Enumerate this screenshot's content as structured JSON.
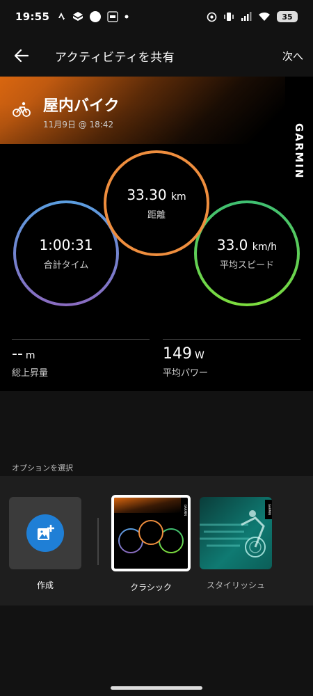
{
  "status_bar": {
    "time": "19:55",
    "battery": "35"
  },
  "header": {
    "title": "アクティビティを共有",
    "next_label": "次へ"
  },
  "activity": {
    "title": "屋内バイク",
    "date": "11月9日 @ 18:42",
    "brand": "GARMIN",
    "brand_color": "#d9660f"
  },
  "metrics": {
    "time": {
      "value": "1:00:31",
      "label": "合計タイム"
    },
    "distance": {
      "value": "33.30",
      "unit": "km",
      "label": "距離"
    },
    "speed": {
      "value": "33.0",
      "unit": "km/h",
      "label": "平均スピード"
    }
  },
  "stats": [
    {
      "value": "--",
      "unit": "m",
      "label": "総上昇量"
    },
    {
      "value": "149",
      "unit": "W",
      "label": "平均パワー"
    }
  ],
  "options": {
    "section_label": "オプションを選択",
    "items": [
      {
        "label": "作成"
      },
      {
        "label": "クラシック"
      },
      {
        "label": "スタイリッシュ"
      }
    ],
    "thumb_brand": "GARMIN"
  },
  "colors": {
    "time_ring": "#5b9ee0",
    "distance_ring": "#ef8e3e",
    "speed_ring": "#3fbf72",
    "create_button": "#1f7fd6"
  }
}
